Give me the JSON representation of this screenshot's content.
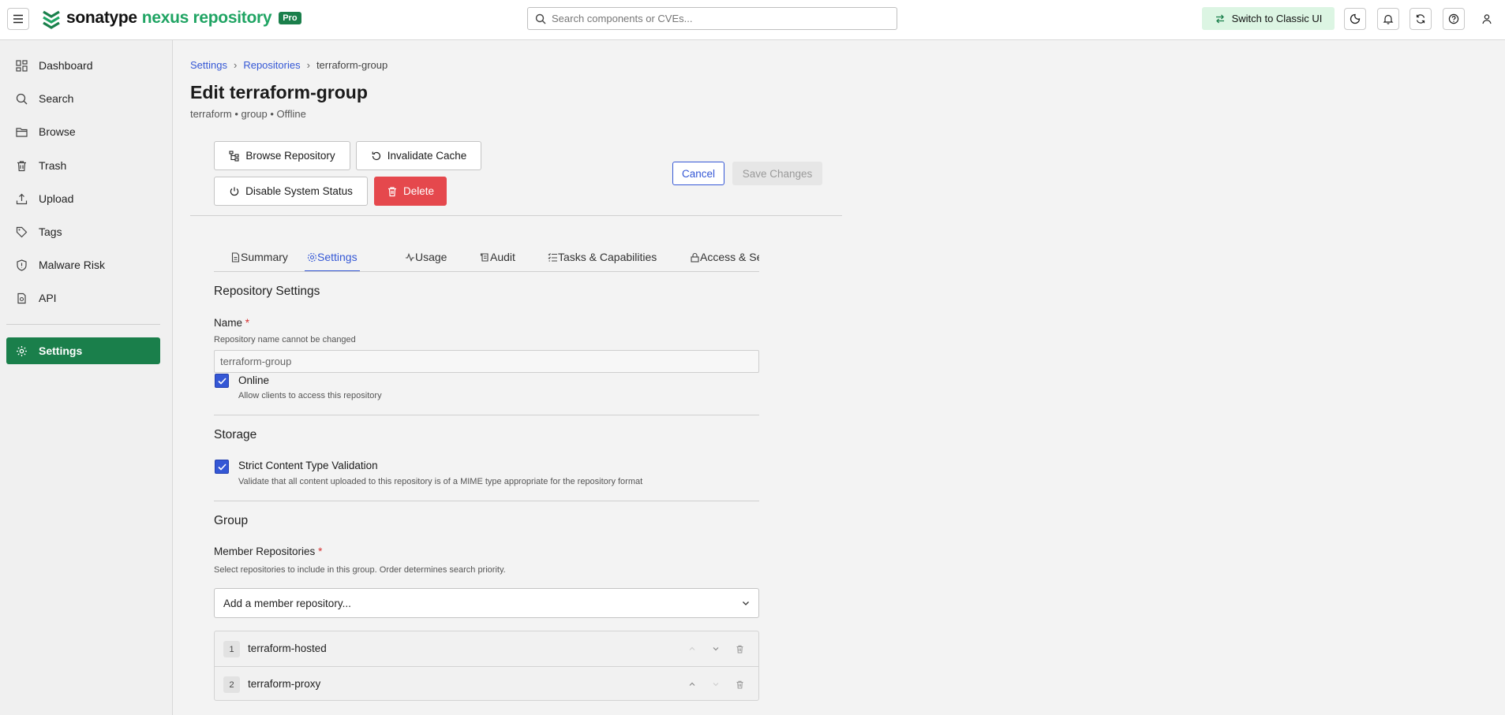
{
  "header": {
    "logo_brand": "sonatype",
    "logo_product": "nexus repository",
    "pro_badge": "Pro",
    "search_placeholder": "Search components or CVEs...",
    "classic_ui_label": "Switch to Classic UI"
  },
  "sidebar": {
    "items": [
      {
        "label": "Dashboard",
        "icon": "dashboard-icon"
      },
      {
        "label": "Search",
        "icon": "search-icon"
      },
      {
        "label": "Browse",
        "icon": "folder-icon"
      },
      {
        "label": "Trash",
        "icon": "trash-icon"
      },
      {
        "label": "Upload",
        "icon": "upload-icon"
      },
      {
        "label": "Tags",
        "icon": "tag-icon"
      },
      {
        "label": "Malware Risk",
        "icon": "shield-icon"
      },
      {
        "label": "API",
        "icon": "api-icon"
      }
    ],
    "settings_label": "Settings"
  },
  "breadcrumb": {
    "settings": "Settings",
    "repositories": "Repositories",
    "current": "terraform-group"
  },
  "page": {
    "title": "Edit terraform-group",
    "subtitle": "terraform • group • Offline"
  },
  "actions": {
    "browse": "Browse Repository",
    "invalidate": "Invalidate Cache",
    "disable": "Disable System Status",
    "delete": "Delete",
    "cancel": "Cancel",
    "save": "Save Changes"
  },
  "tabs": [
    "Summary",
    "Settings",
    "Usage",
    "Audit",
    "Tasks & Capabilities",
    "Access & Security"
  ],
  "active_tab": "Settings",
  "repo_settings": {
    "title": "Repository Settings",
    "name_label": "Name",
    "required_mark": "*",
    "name_help": "Repository name cannot be changed",
    "name_value": "terraform-group",
    "online_label": "Online",
    "online_help": "Allow clients to access this repository"
  },
  "storage": {
    "title": "Storage",
    "strict_label": "Strict Content Type Validation",
    "strict_help": "Validate that all content uploaded to this repository is of a MIME type appropriate for the repository format"
  },
  "group": {
    "title": "Group",
    "members_label": "Member Repositories",
    "members_help": "Select repositories to include in this group. Order determines search priority.",
    "add_placeholder": "Add a member repository...",
    "members": [
      {
        "index": "1",
        "name": "terraform-hosted"
      },
      {
        "index": "2",
        "name": "terraform-proxy"
      }
    ]
  },
  "colors": {
    "accent": "#3457d5",
    "brand_green": "#1a7f4b",
    "danger": "#e5484d"
  }
}
